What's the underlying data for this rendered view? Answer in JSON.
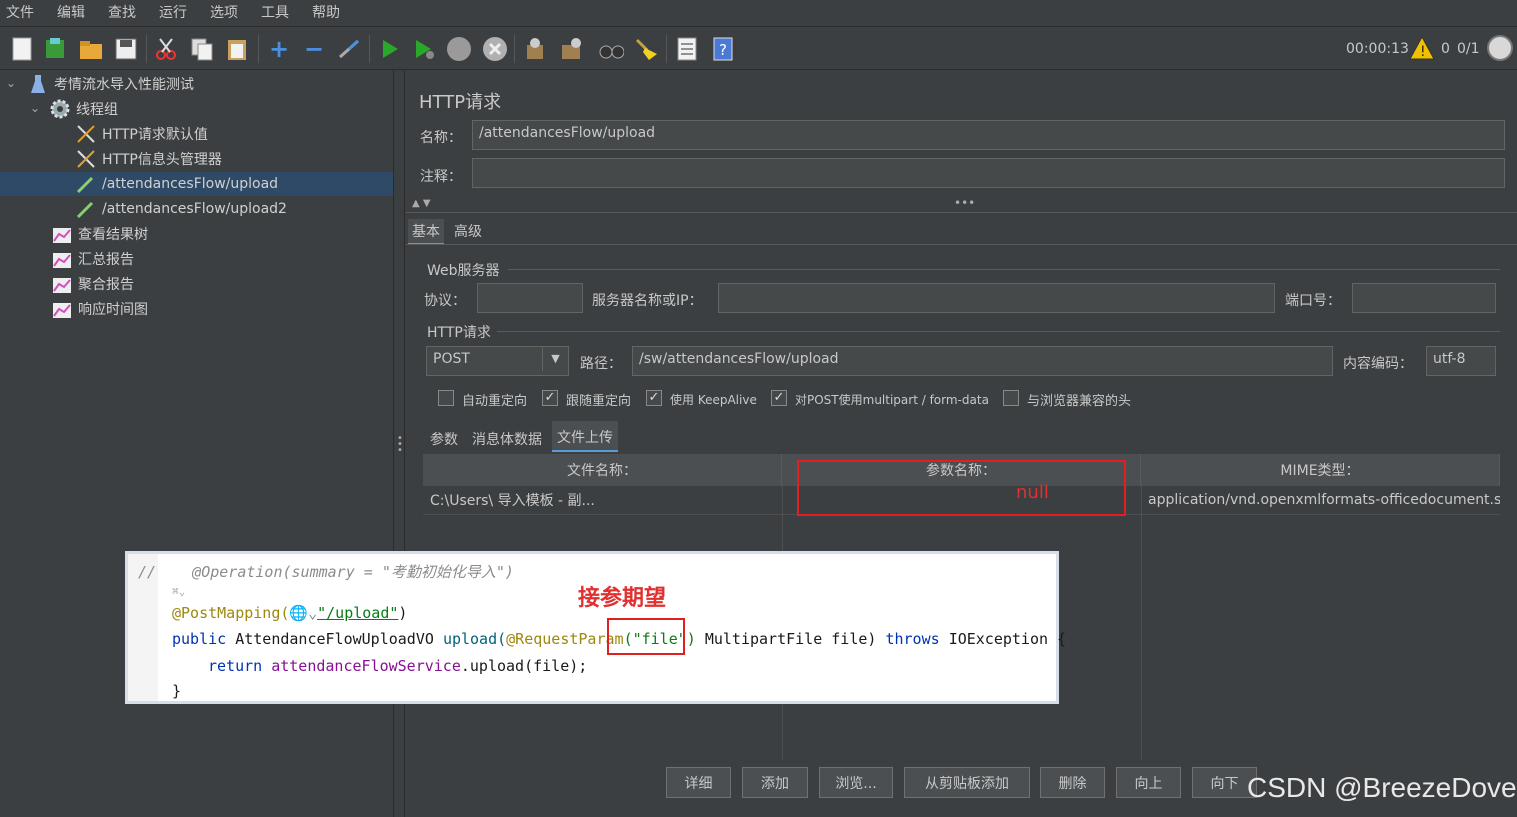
{
  "menu": [
    "文件",
    "编辑",
    "查找",
    "运行",
    "选项",
    "工具",
    "帮助"
  ],
  "status": {
    "elapsed": "00:00:13",
    "errors": "0",
    "threads": "0/1"
  },
  "tree": {
    "root": "考情流水导入性能测试",
    "thread_group": "线程组",
    "items": [
      {
        "label": "HTTP请求默认值",
        "icon": "wrench-icon"
      },
      {
        "label": "HTTP信息头管理器",
        "icon": "wrench-icon"
      },
      {
        "label": "/attendancesFlow/upload",
        "icon": "pipette-icon",
        "selected": true
      },
      {
        "label": "/attendancesFlow/upload2",
        "icon": "pipette-icon"
      }
    ],
    "listeners": [
      "查看结果树",
      "汇总报告",
      "聚合报告",
      "响应时间图"
    ]
  },
  "panel": {
    "title": "HTTP请求",
    "name_label": "名称：",
    "name_value": "/attendancesFlow/upload",
    "comment_label": "注释：",
    "comment_value": "",
    "tabs": [
      "基本",
      "高级"
    ],
    "web_server": "Web服务器",
    "protocol_label": "协议：",
    "server_label": "服务器名称或IP：",
    "port_label": "端口号：",
    "http_request": "HTTP请求",
    "method": "POST",
    "path_label": "路径：",
    "path_value": "/sw/attendancesFlow/upload",
    "encoding_label": "内容编码：",
    "encoding_value": "utf-8",
    "checkboxes": [
      {
        "label": "自动重定向",
        "checked": false
      },
      {
        "label": "跟随重定向",
        "checked": true
      },
      {
        "label": "使用 KeepAlive",
        "checked": true
      },
      {
        "label": "对POST使用multipart / form-data",
        "checked": true
      },
      {
        "label": "与浏览器兼容的头",
        "checked": false
      }
    ],
    "subtabs": [
      "参数",
      "消息体数据",
      "文件上传"
    ],
    "table": {
      "headers": [
        "文件名称：",
        "参数名称：",
        "MIME类型："
      ],
      "row": [
        "C:\\Users\\                        导入模板 - 副...",
        "",
        "application/vnd.openxmlformats-officedocument.sp..."
      ]
    },
    "buttons": [
      "详细",
      "添加",
      "浏览...",
      "从剪贴板添加",
      "删除",
      "向上",
      "向下"
    ]
  },
  "annotations": {
    "null_text": "null",
    "expect_text": "接参期望",
    "watermark": "CSDN @BreezeDove"
  },
  "code": {
    "line1": "//    @Operation(summary = \"考勤初始化导入\")",
    "line2": "@PostMapping(",
    "line2b": "\"/upload\"",
    "line2c": ")",
    "line3a": "public ",
    "line3b": "AttendanceFlowUploadVO ",
    "line3c": "upload(",
    "line3d": "@RequestParam",
    "line3e": "(\"file\") ",
    "line3f": "MultipartFile file) ",
    "line3g": "throws ",
    "line3h": "IOException {",
    "line4a": "return ",
    "line4b": "attendanceFlowService",
    "line4c": ".upload(file);",
    "line5": "}"
  },
  "colors": {
    "selected": "#2f4a66",
    "red": "#e02020",
    "bg": "#3c3f41"
  }
}
